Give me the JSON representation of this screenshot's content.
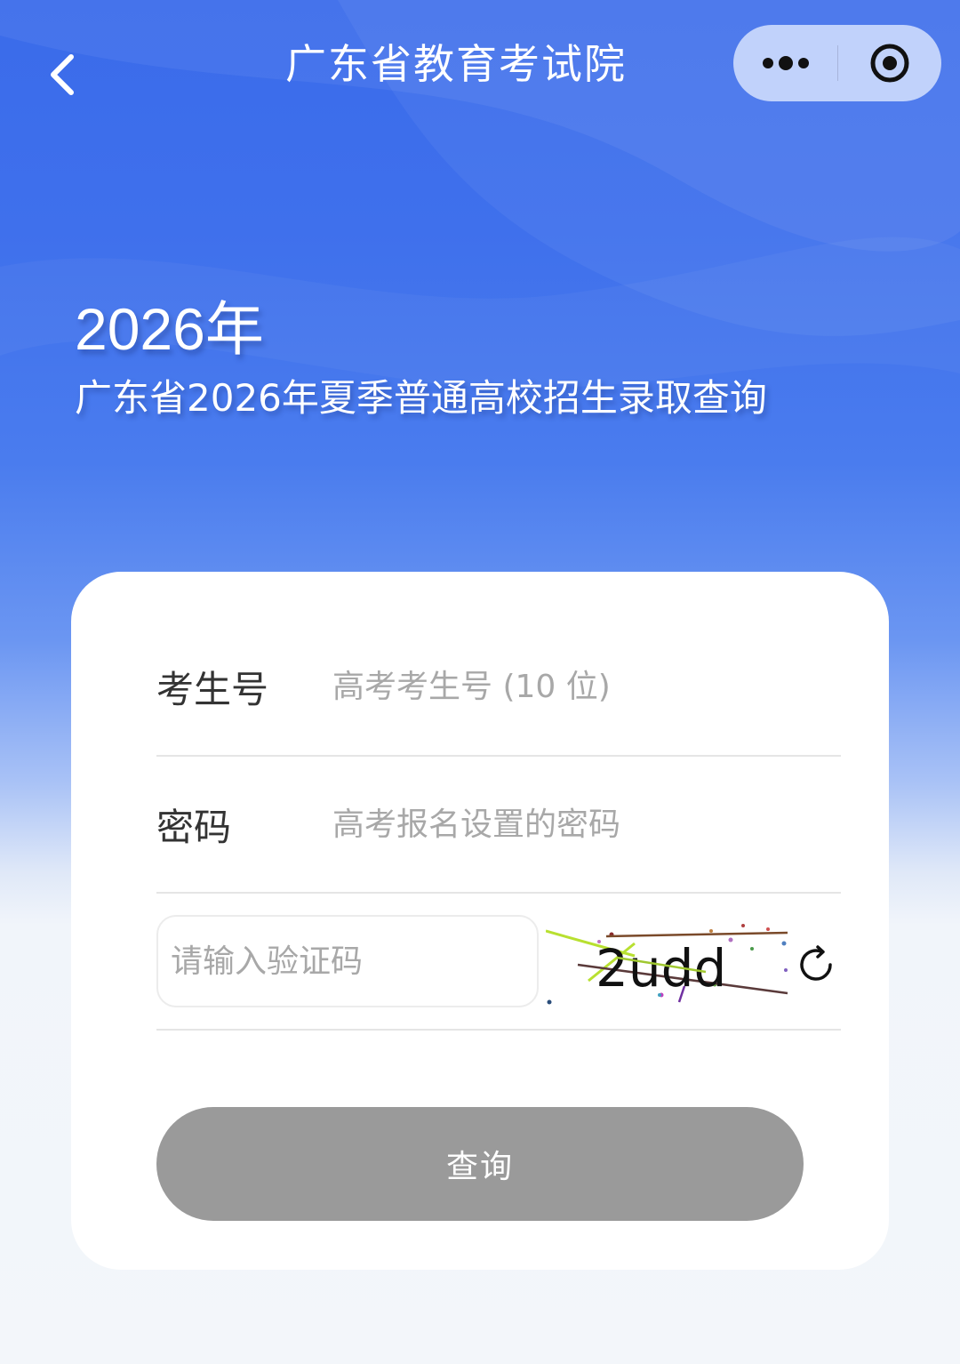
{
  "nav": {
    "title": "广东省教育考试院",
    "back_icon": "chevron-left-icon",
    "more_icon": "more-dots-icon",
    "close_icon": "target-close-icon"
  },
  "hero": {
    "year": "2026年",
    "subtitle": "广东省2026年夏季普通高校招生录取查询"
  },
  "form": {
    "candidate_number": {
      "label": "考生号",
      "placeholder": "高考考生号 (10 位)",
      "value": ""
    },
    "password": {
      "label": "密码",
      "placeholder": "高考报名设置的密码",
      "value": ""
    },
    "captcha": {
      "placeholder": "请输入验证码",
      "value": "",
      "image_text": "2udd",
      "refresh_icon": "refresh-icon"
    },
    "submit_label": "查询"
  },
  "colors": {
    "primary_blue": "#3a6bea",
    "button_disabled": "#9a9a9a",
    "placeholder": "#a8a8a8",
    "label": "#333333"
  }
}
